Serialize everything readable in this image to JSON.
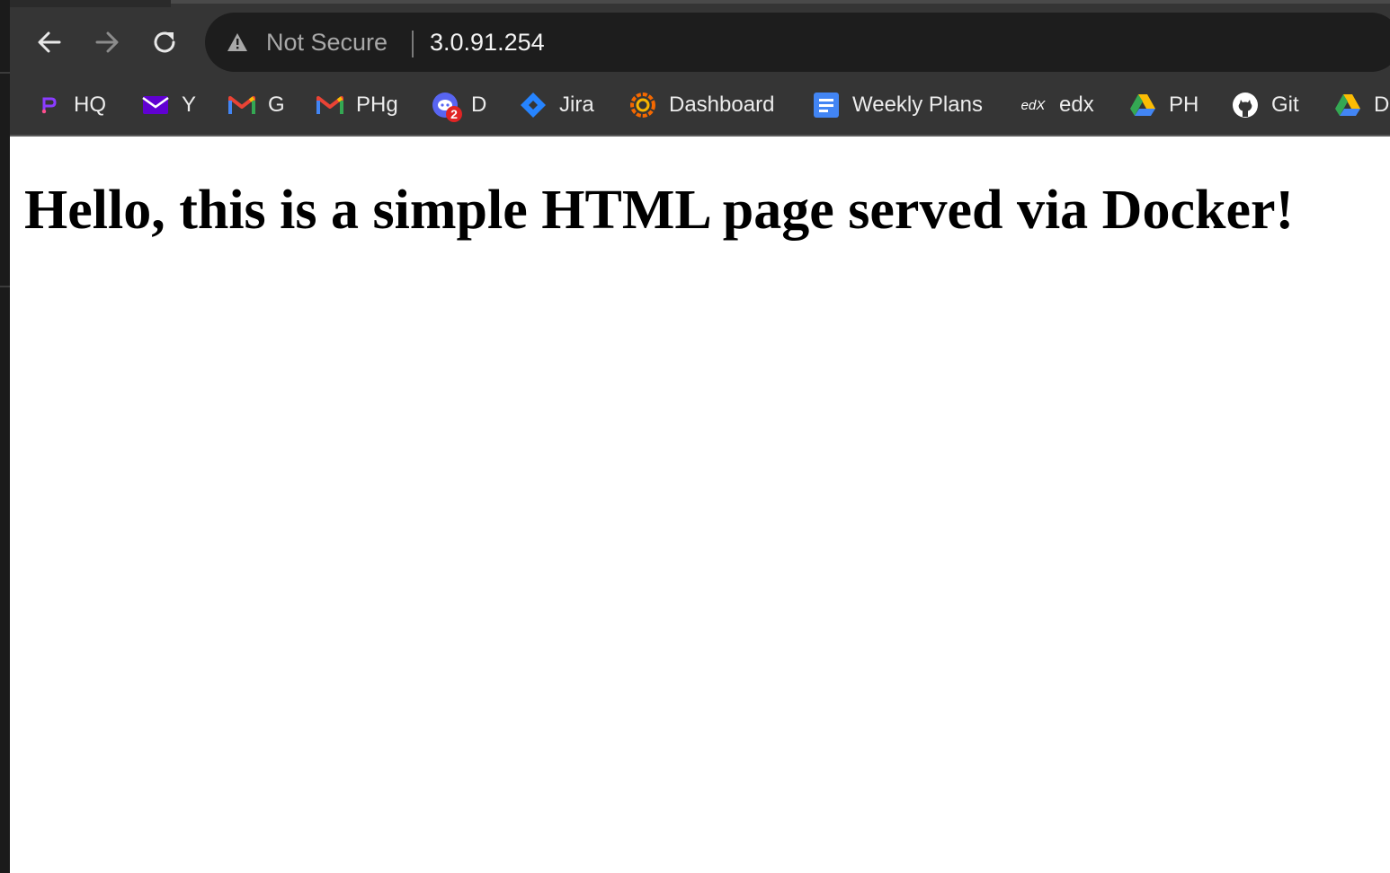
{
  "browser": {
    "nav": {
      "back_icon": "arrow-left-icon",
      "forward_icon": "arrow-right-icon",
      "reload_icon": "reload-icon"
    },
    "omnibox": {
      "security_icon": "warning-triangle-icon",
      "security_label": "Not Secure",
      "url": "3.0.91.254"
    },
    "bookmarks": [
      {
        "label": "HQ",
        "icon": "hq-icon"
      },
      {
        "label": "Y",
        "icon": "yahoo-mail-icon"
      },
      {
        "label": "G",
        "icon": "gmail-icon"
      },
      {
        "label": "PHg",
        "icon": "gmail-icon"
      },
      {
        "label": "D",
        "icon": "discord-icon",
        "badge": "2"
      },
      {
        "label": "Jira",
        "icon": "jira-icon"
      },
      {
        "label": "Dashboard",
        "icon": "grafana-icon"
      },
      {
        "label": "Weekly Plans",
        "icon": "google-docs-icon"
      },
      {
        "label": "edx",
        "icon": "edx-icon",
        "icon_text": "edX"
      },
      {
        "label": "PH",
        "icon": "google-drive-icon"
      },
      {
        "label": "Git",
        "icon": "github-icon"
      },
      {
        "label": "D",
        "icon": "google-drive-icon"
      }
    ]
  },
  "page": {
    "heading": "Hello, this is a simple HTML page served via Docker!"
  },
  "colors": {
    "toolbar_bg": "#353535",
    "omnibox_bg": "#1d1d1d",
    "page_bg": "#ffffff",
    "heading_color": "#000000"
  }
}
